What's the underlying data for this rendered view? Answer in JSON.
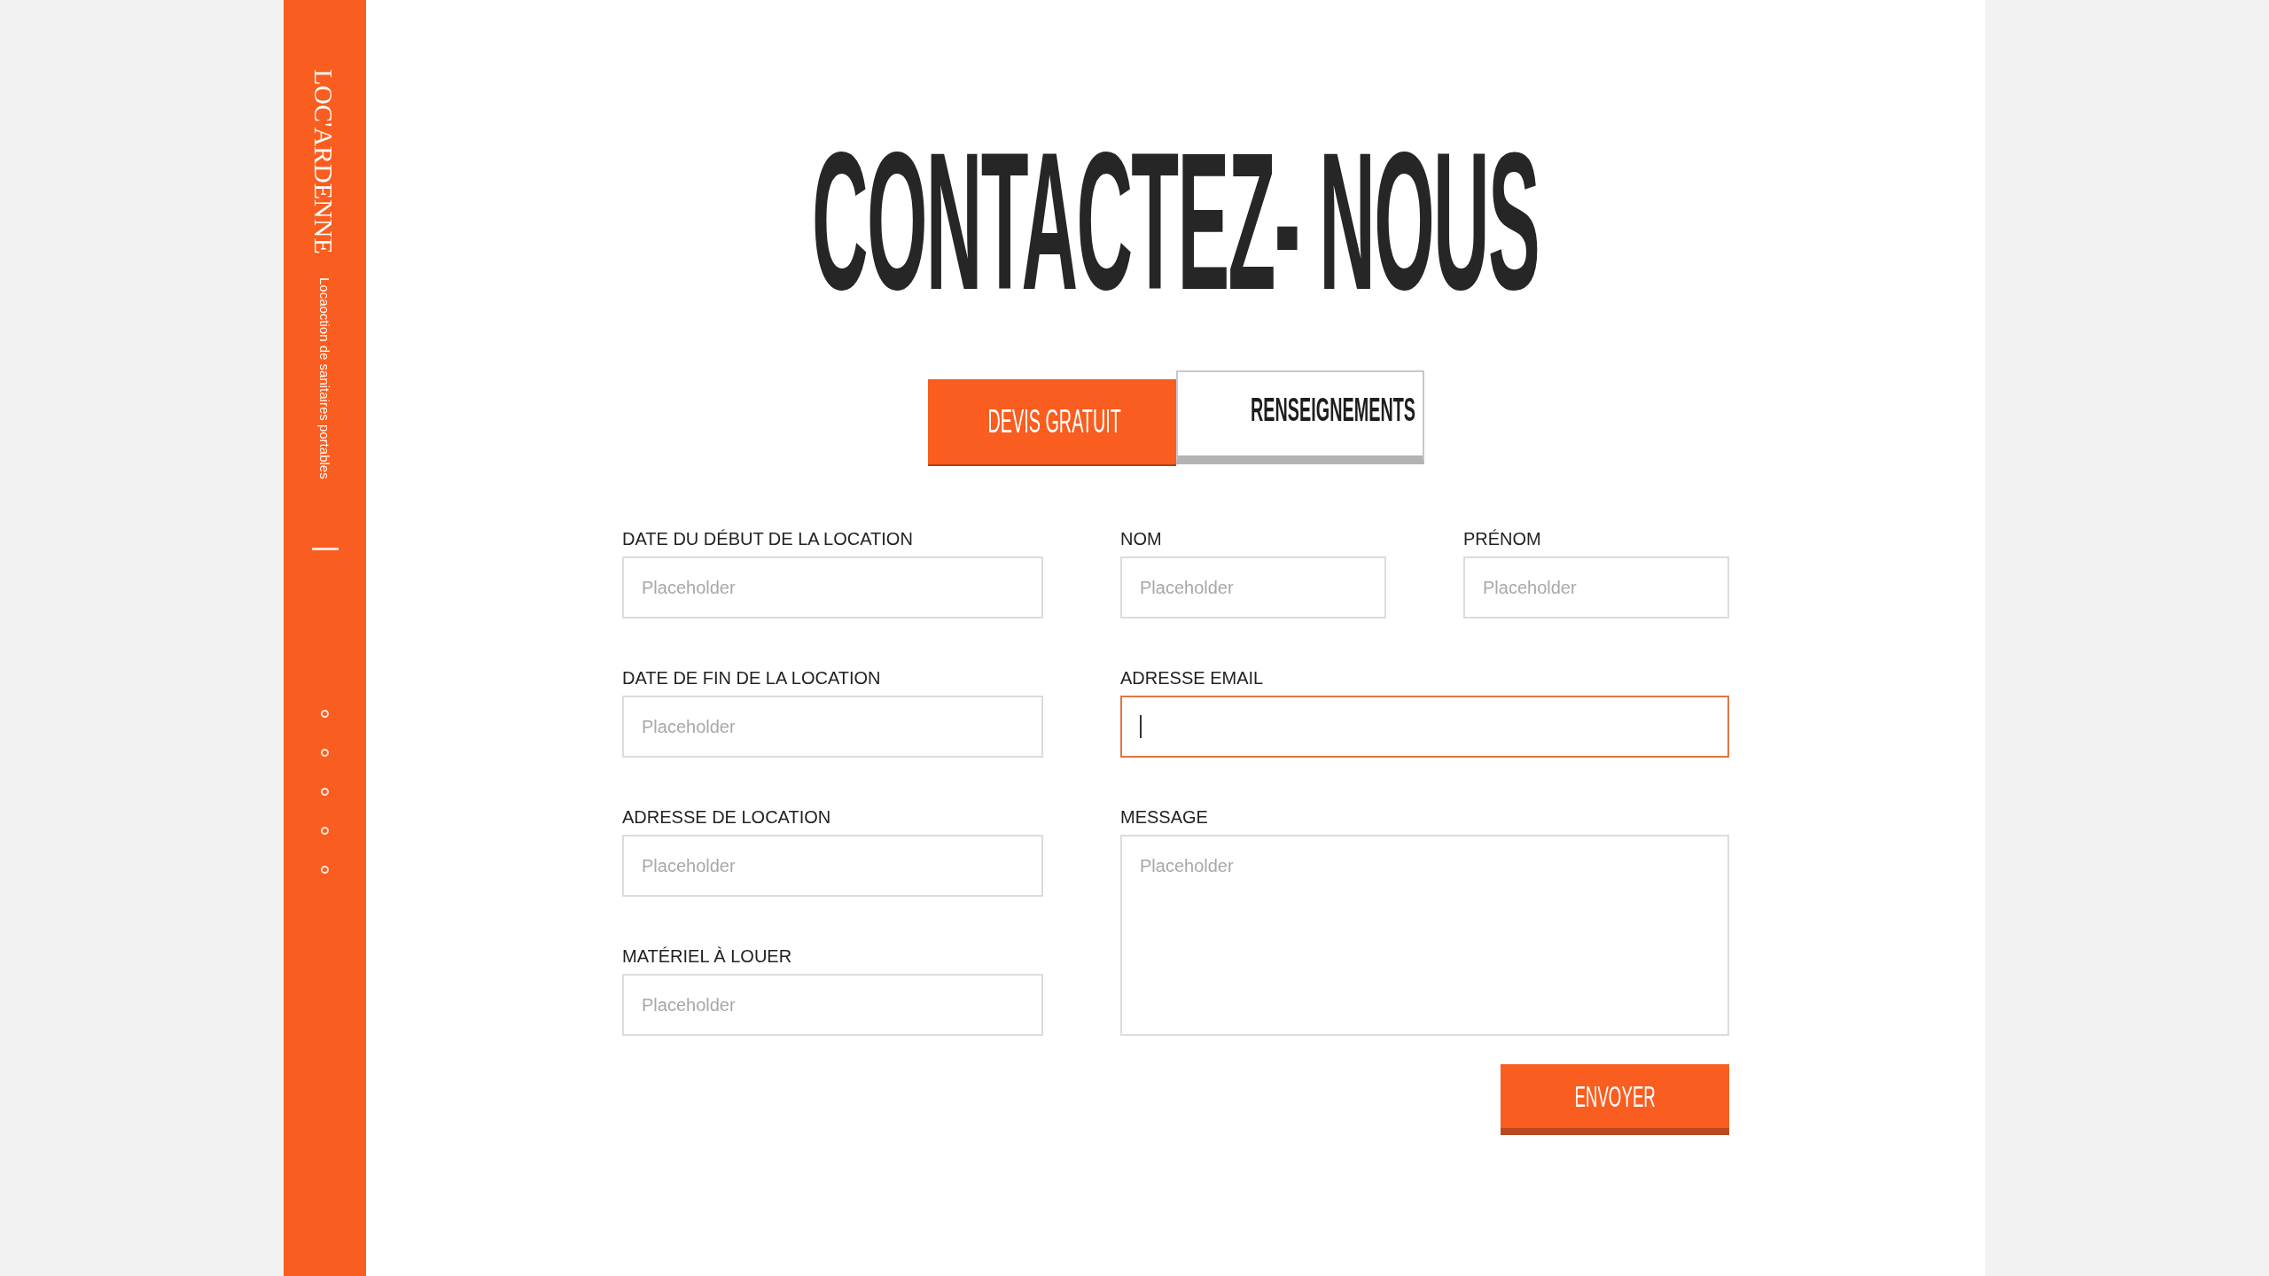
{
  "sidebar": {
    "logo": "LOC'ARDENNE",
    "tagline": "Locaoction de sanitaires portables",
    "nav_dots": [
      {
        "selected": false
      },
      {
        "selected": false
      },
      {
        "selected": false
      },
      {
        "selected": false
      },
      {
        "selected": false
      }
    ]
  },
  "title": "CONTACTEZ- NOUS",
  "tabs": [
    {
      "label": "DEVIS GRATUIT",
      "selected": true
    },
    {
      "label": "RENSEIGNEMENTS",
      "selected": false
    }
  ],
  "form": {
    "fields": [
      {
        "label": "DATE DU DÉBUT DE LA LOCATION",
        "placeholder": "Placeholder",
        "kind": "input",
        "focused": false
      },
      {
        "label": "NOM",
        "placeholder": "Placeholder",
        "kind": "input",
        "focused": false
      },
      {
        "label": "PRÉNOM",
        "placeholder": "Placeholder",
        "kind": "input",
        "focused": false
      },
      {
        "label": "DATE DE FIN DE LA LOCATION",
        "placeholder": "Placeholder",
        "kind": "input",
        "focused": false
      },
      {
        "label": "ADRESSE EMAIL",
        "kind": "input",
        "focused": true
      },
      {
        "label": "ADRESSE DE LOCATION",
        "placeholder": "Placeholder",
        "kind": "input",
        "focused": false
      },
      {
        "label": "MESSAGE",
        "placeholder": "Placeholder",
        "kind": "textarea",
        "focused": false
      },
      {
        "label": "MATÉRIEL À LOUER",
        "placeholder": "Placeholder",
        "kind": "input",
        "focused": false
      }
    ],
    "submit": "ENVOYER"
  }
}
